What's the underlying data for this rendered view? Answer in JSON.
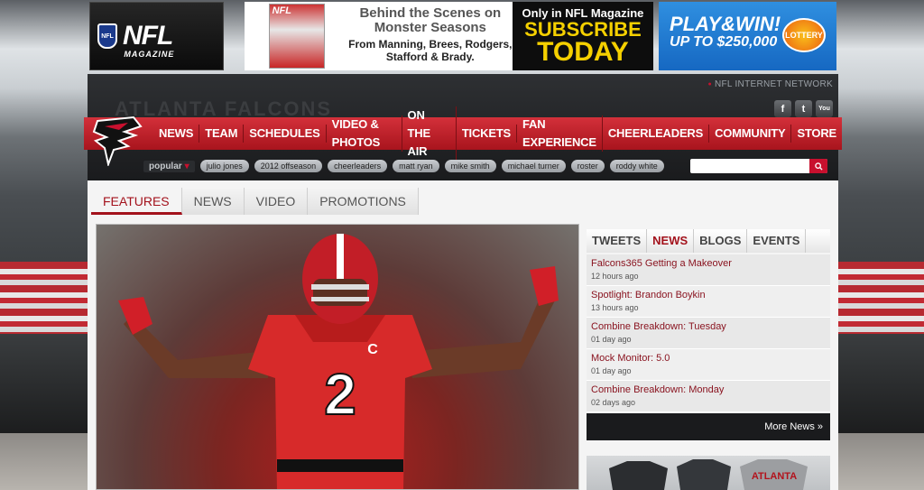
{
  "ads": {
    "nfl_magazine": {
      "word": "NFL",
      "sub": "MAGAZINE",
      "shield": "NFL"
    },
    "cover_label": "NFL",
    "behind": {
      "headline": "Behind the Scenes on Monster Seasons",
      "sub": "From Manning, Brees, Rodgers, Stafford & Brady."
    },
    "subscribe": {
      "line1": "Only in NFL Magazine",
      "line2": "SUBSCRIBE",
      "line3": "TODAY"
    },
    "play": {
      "line1": "PLAY&WIN!",
      "line2": "UP TO $250,000",
      "badge": "LOTTERY"
    }
  },
  "header": {
    "network": "NFL INTERNET NETWORK",
    "ghost_title": "ATLANTA FALCONS",
    "social": [
      "f",
      "t",
      "You"
    ]
  },
  "nav": [
    "NEWS",
    "TEAM",
    "SCHEDULES",
    "VIDEO & PHOTOS",
    "ON THE AIR",
    "TICKETS",
    "FAN EXPERIENCE",
    "CHEERLEADERS",
    "COMMUNITY",
    "STORE"
  ],
  "popular": {
    "label": "popular",
    "tags": [
      "julio jones",
      "2012 offseason",
      "cheerleaders",
      "matt ryan",
      "mike smith",
      "michael turner",
      "roster",
      "roddy white"
    ]
  },
  "search": {
    "placeholder": ""
  },
  "main_tabs": [
    "FEATURES",
    "NEWS",
    "VIDEO",
    "PROMOTIONS"
  ],
  "hero": {
    "jersey_number": "2",
    "captain_letter": "C"
  },
  "sidebar": {
    "tabs": [
      "TWEETS",
      "NEWS",
      "BLOGS",
      "EVENTS"
    ],
    "news": [
      {
        "title": "Falcons365 Getting a Makeover",
        "time": "12 hours ago"
      },
      {
        "title": "Spotlight: Brandon Boykin",
        "time": "13 hours ago"
      },
      {
        "title": "Combine Breakdown: Tuesday",
        "time": "01 day ago"
      },
      {
        "title": "Mock Monitor: 5.0",
        "time": "01 day ago"
      },
      {
        "title": "Combine Breakdown: Monday",
        "time": "02 days ago"
      }
    ],
    "more": "More News »",
    "merch_label": "ATLANTA"
  },
  "colors": {
    "brand_red": "#c8102e",
    "dark": "#1a1b1d",
    "link": "#8a1420"
  }
}
